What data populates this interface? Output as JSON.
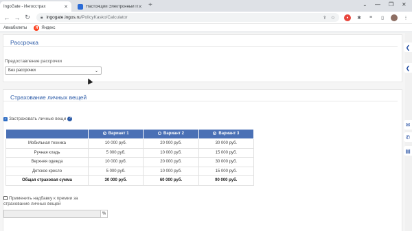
{
  "browser": {
    "tabs": [
      {
        "title": "IngoGate - Ингосстрах",
        "active": true
      },
      {
        "title": "Настоящий Электронный Поли...",
        "active": false
      }
    ],
    "url_host": "ingogate.ingos.ru",
    "url_path": "/PolicyKasko/Calculator",
    "bookmarks": [
      "Авиабилеты",
      "Яндекс"
    ]
  },
  "installments": {
    "title": "Рассрочка",
    "field_label": "Предоставление рассрочки",
    "selected": "Без рассрочки"
  },
  "belongings": {
    "title": "Страхование личных вещей",
    "insure_label": "Застраховать личные вещи",
    "insure_checked": true,
    "variants": [
      "Вариант 1",
      "Вариант 2",
      "Вариант 3"
    ],
    "selected_variant": 2,
    "rows": [
      {
        "name": "Мобильная техника",
        "values": [
          "10 000 руб.",
          "20 000 руб.",
          "30 000 руб."
        ]
      },
      {
        "name": "Ручная кладь",
        "values": [
          "5 000 руб.",
          "10 000 руб.",
          "15 000 руб."
        ]
      },
      {
        "name": "Верхняя одежда",
        "values": [
          "10 000 руб.",
          "20 000 руб.",
          "30 000 руб."
        ]
      },
      {
        "name": "Детское кресло",
        "values": [
          "5 000 руб.",
          "10 000 руб.",
          "15 000 руб."
        ]
      }
    ],
    "total": {
      "name": "Общая страховая сумма",
      "values": [
        "30 000 руб.",
        "60 000 руб.",
        "90 000 руб."
      ]
    },
    "surcharge_label_1": "Применить надбавку к премии за",
    "surcharge_label_2": "страхование личных вещей",
    "surcharge_unit": "%"
  }
}
